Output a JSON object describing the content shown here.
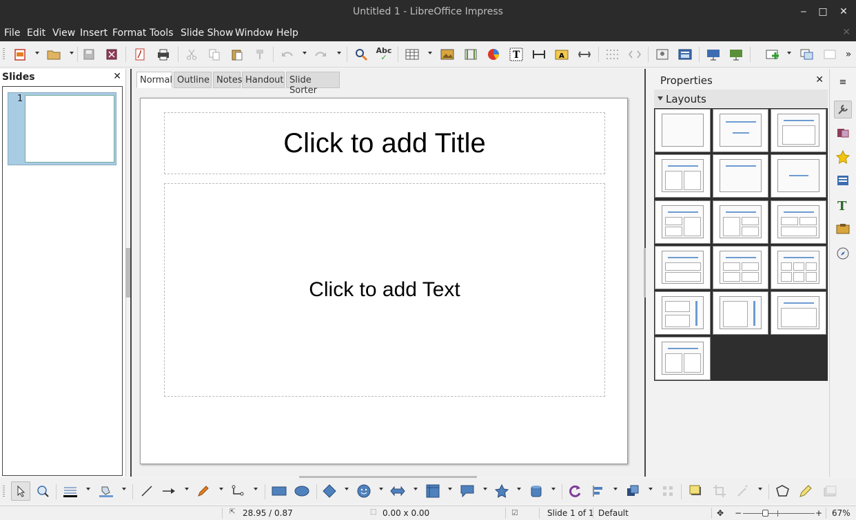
{
  "window": {
    "title": "Untitled 1 - LibreOffice Impress",
    "minimize": "‒",
    "maximize": "□",
    "close": "✕"
  },
  "menu": {
    "items": [
      "File",
      "Edit",
      "View",
      "Insert",
      "Format",
      "Tools",
      "Slide Show",
      "Window",
      "Help"
    ],
    "close": "✕"
  },
  "slides_panel": {
    "title": "Slides",
    "close": "✕",
    "slide_number": "1"
  },
  "view_tabs": [
    "Normal",
    "Outline",
    "Notes",
    "Handout",
    "Slide Sorter"
  ],
  "slide": {
    "title_placeholder": "Click to add Title",
    "text_placeholder": "Click to add Text"
  },
  "properties": {
    "title": "Properties",
    "close": "✕",
    "section": "Layouts"
  },
  "toolbar": {
    "spellcheck_label": "Abc"
  },
  "status": {
    "position": "28.95 / 0.87",
    "size": "0.00 x 0.00",
    "slide": "Slide 1 of 1",
    "master": "Default",
    "zoom": "67%",
    "zoom_minus": "−",
    "zoom_plus": "+"
  },
  "colors": {
    "accent": "#6c9bd2",
    "dark_chrome": "#2b2b2b",
    "selection": "#a9cce5"
  }
}
